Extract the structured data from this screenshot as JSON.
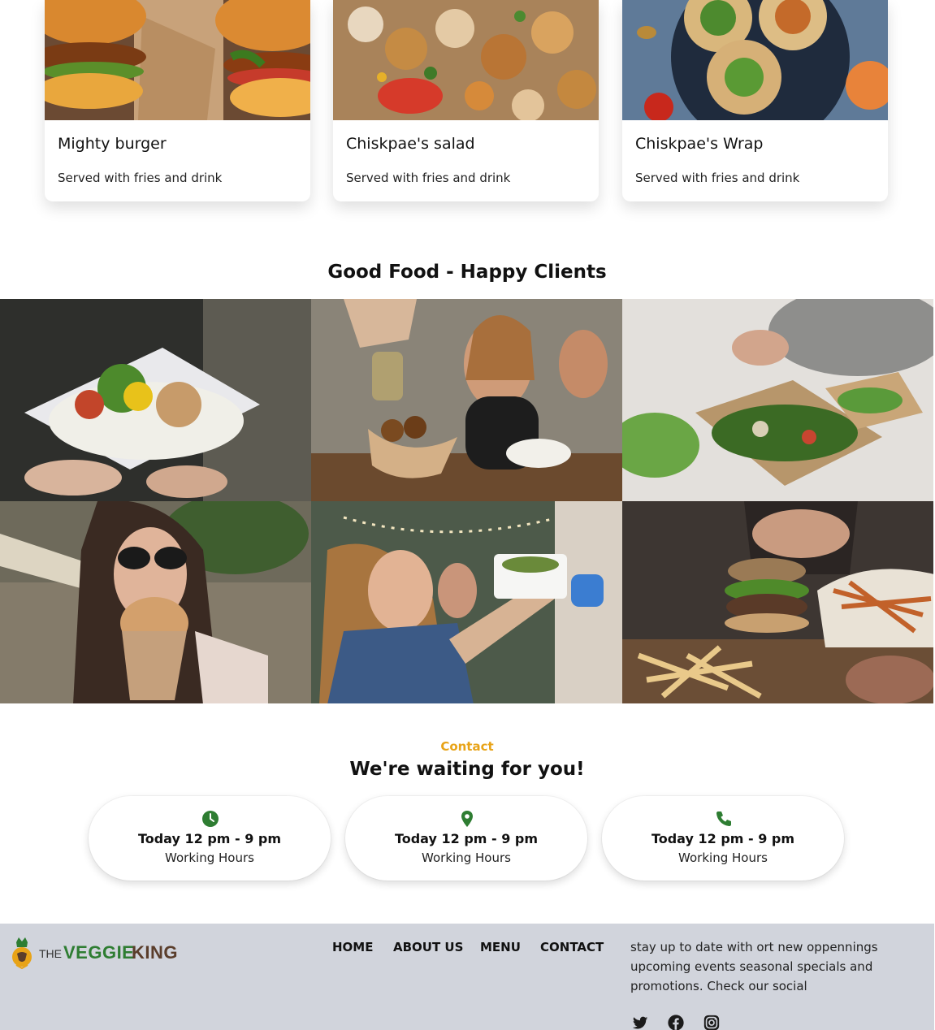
{
  "menu_cards": [
    {
      "name": "Mighty burger",
      "description": "Served with fries and drink",
      "image": "burger-photo"
    },
    {
      "name": "Chiskpae's salad",
      "description": "Served with fries and drink",
      "image": "salad-photo"
    },
    {
      "name": "Chiskpae's Wrap",
      "description": "Served with fries and drink",
      "image": "wrap-photo"
    }
  ],
  "gallery": {
    "title": "Good Food - Happy Clients",
    "photos": [
      "bowl-photo",
      "sauce-photo",
      "salad-boxes-photo",
      "woman-burger-photo",
      "food-truck-photo",
      "burger-fries-photo"
    ]
  },
  "contact": {
    "kicker": "Contact",
    "title": "We're waiting for you!",
    "cards": [
      {
        "icon": "clock-icon",
        "line1": "Today 12 pm - 9 pm",
        "line2": "Working Hours"
      },
      {
        "icon": "location-pin-icon",
        "line1": "Today 12 pm - 9 pm",
        "line2": "Working Hours"
      },
      {
        "icon": "phone-icon",
        "line1": "Today 12 pm - 9 pm",
        "line2": "Working Hours"
      }
    ]
  },
  "footer": {
    "logo": {
      "the": "THE",
      "veggie": "VEGGIE",
      "king": "KING"
    },
    "nav": [
      "HOME",
      "ABOUT US",
      "MENU",
      "CONTACT"
    ],
    "about": "stay up to date with ort new oppennings upcoming events seasonal specials and promotions. Check our social",
    "social": [
      "twitter-icon",
      "facebook-icon",
      "instagram-icon"
    ]
  },
  "colors": {
    "accent": "#e8a317",
    "brand_green": "#2e7d32",
    "brand_brown": "#5a3d2b",
    "footer_bg": "#d1d4dc"
  }
}
